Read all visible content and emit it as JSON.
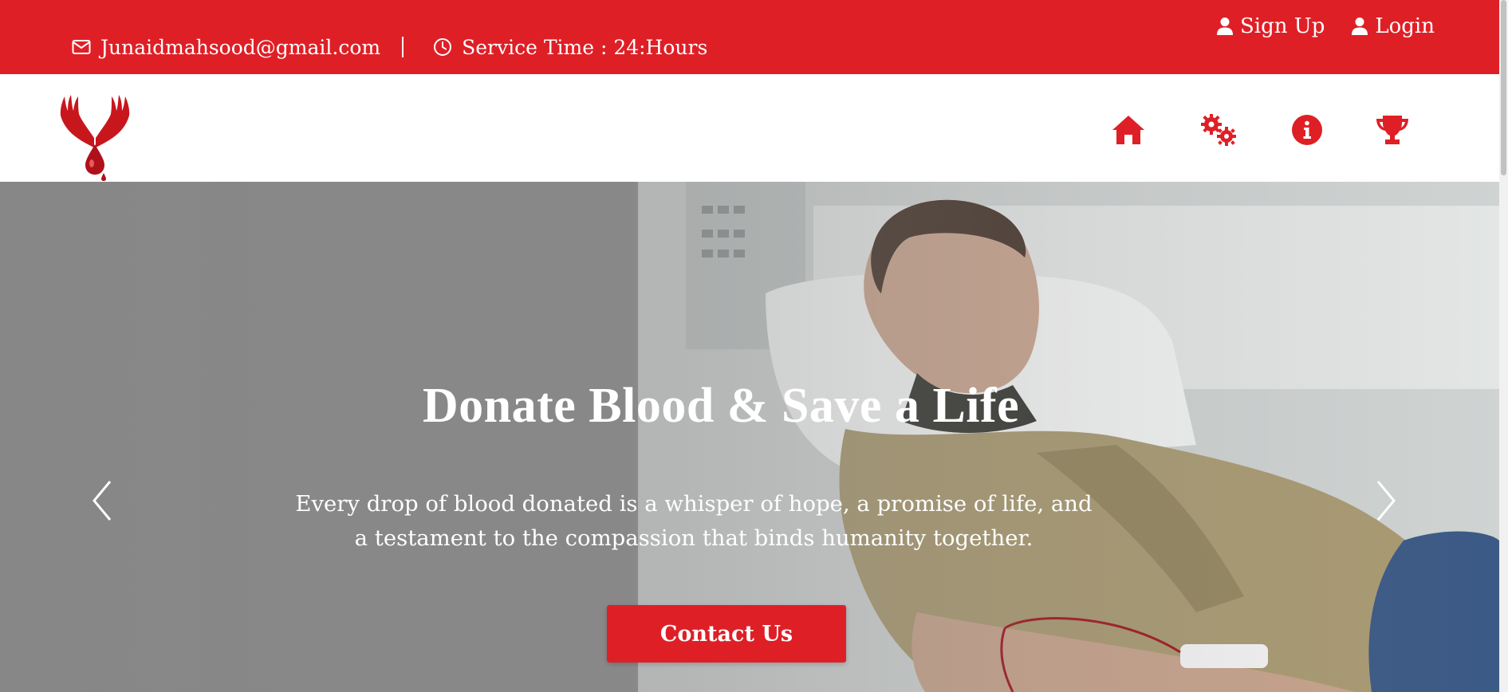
{
  "topbar": {
    "email": "Junaidmahsood@gmail.com",
    "service_time": "Service Time : 24:Hours",
    "signup_label": "Sign Up",
    "login_label": "Login",
    "background_color": "#df1f26"
  },
  "navbar": {
    "logo_icon": "blood-drop-hands-logo",
    "items": [
      {
        "icon": "home-icon"
      },
      {
        "icon": "gears-icon"
      },
      {
        "icon": "info-icon"
      },
      {
        "icon": "trophy-icon"
      }
    ],
    "icon_color": "#df1f26"
  },
  "hero": {
    "title": "Donate Blood & Save a Life",
    "subtitle": "Every drop of blood donated is a whisper of hope, a promise of life, and a testament to the compassion that binds humanity together.",
    "cta_label": "Contact Us",
    "prev_icon": "chevron-left-icon",
    "next_icon": "chevron-right-icon"
  }
}
